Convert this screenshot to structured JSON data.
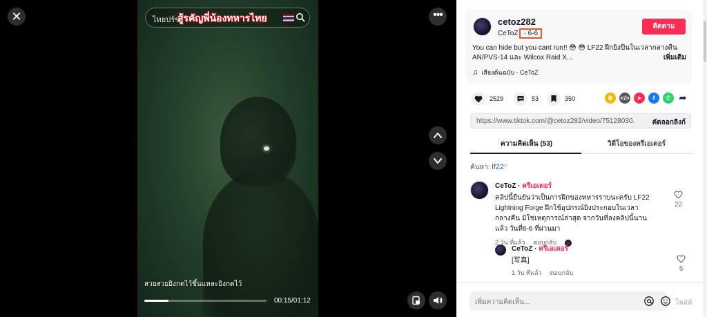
{
  "player": {
    "search_placeholder": "ไทยปร์ช",
    "search_overlay_text": "สู้รคัญพี่น้องทหารไทย",
    "caption": "สวยสวยยิงกดไว้ขึ้นแหละยิงกดไว้",
    "progress_fraction": 0.2,
    "time": "00:15/01:12",
    "icons": {
      "close": "close-icon",
      "more": "more-icon",
      "up": "chevron-up-icon",
      "down": "chevron-down-icon",
      "pip": "picture-in-picture-icon",
      "volume": "volume-icon"
    }
  },
  "post": {
    "username": "cetoz282",
    "display_name": "CeToZ",
    "separator": "·",
    "date": "6-6",
    "follow_label": "ติดตาม",
    "description": "You can hide but you cant run!! 😳 😳  LF22 ฝึกยิงปืนในเวลากลางคืน AN/PVS-14 และ Wilcox Raid X...",
    "more_label": "เพิ่มเติม",
    "music": "เสียงต้นฉบับ - CeToZ"
  },
  "actions": {
    "likes": "2529",
    "comments": "53",
    "saves": "350"
  },
  "share": {
    "url": "https://www.tiktok.com/@cetoz282/video/75128030...",
    "copy_label": "คัดลอกลิงก์"
  },
  "tabs": {
    "comments_label": "ความคิดเห็น (53)",
    "creator_videos_label": "วิดีโอของครีเอเตอร์"
  },
  "search_hint": {
    "prefix": "ค้นหา:",
    "keyword": "lf22"
  },
  "comments": [
    {
      "name": "CeToZ",
      "badge": "ครีเอเตอร์",
      "text": "คลิปนี้ยืนยันว่าเป็นการฝึกของทหารราบนะครับ LF22 Lightning Forge ฝึกใช้อุปกรณ์ยิงประกอบในเวลากลางคืน มิใช่เหตุการณ์ล่าสุด จากวันที่ลงคลิปนี้นานแล้ว วันที่6-6 ที่ผ่านมา",
      "time": "2 วัน ที่แล้ว",
      "reply": "ตอบกลับ",
      "likes": "22"
    },
    {
      "name": "CeToZ",
      "badge": "ครีเอเตอร์",
      "text": "[写真]",
      "time": "1 วัน ที่แล้ว",
      "reply": "ตอบกลับ",
      "likes": "5"
    }
  ],
  "composer": {
    "placeholder": "เพิ่มความคิดเห็น...",
    "post_label": "โพสต์"
  },
  "colors": {
    "brand": "#fe2c55",
    "highlight_box": "#e8552a",
    "link": "#2b5db9"
  }
}
